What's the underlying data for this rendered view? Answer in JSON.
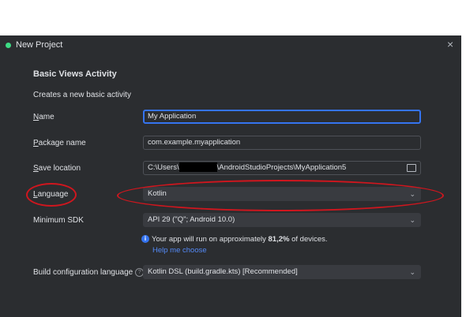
{
  "window": {
    "title": "New Project",
    "close_glyph": "×"
  },
  "template": {
    "heading": "Basic Views Activity",
    "description": "Creates a new basic activity"
  },
  "form": {
    "name": {
      "mnemonic": "N",
      "rest": "ame",
      "value": "My Application"
    },
    "package": {
      "mnemonic": "P",
      "rest": "ackage name",
      "value": "com.example.myapplication"
    },
    "save_location": {
      "mnemonic": "S",
      "rest": "ave location",
      "value_prefix": "C:\\Users\\",
      "value_suffix": "\\AndroidStudioProjects\\MyApplication5"
    },
    "language": {
      "mnemonic": "L",
      "rest": "anguage",
      "value": "Kotlin"
    },
    "min_sdk": {
      "label": "Minimum SDK",
      "value": "API 29 (\"Q\"; Android 10.0)"
    },
    "info": {
      "prefix": "Your app will run on approximately ",
      "percent": "81,2%",
      "suffix": " of devices."
    },
    "help_link": "Help me choose",
    "build_config": {
      "label": "Build configuration language",
      "value": "Kotlin DSL (build.gradle.kts) [Recommended]"
    }
  },
  "icons": {
    "app": "android-studio-icon",
    "folder": "folder-icon",
    "chevron": "chevron-down-icon",
    "info": "info-icon",
    "help": "help-icon"
  },
  "colors": {
    "background": "#2b2d30",
    "focus": "#3574f0",
    "link": "#548af7",
    "annotation": "#d0161e"
  }
}
